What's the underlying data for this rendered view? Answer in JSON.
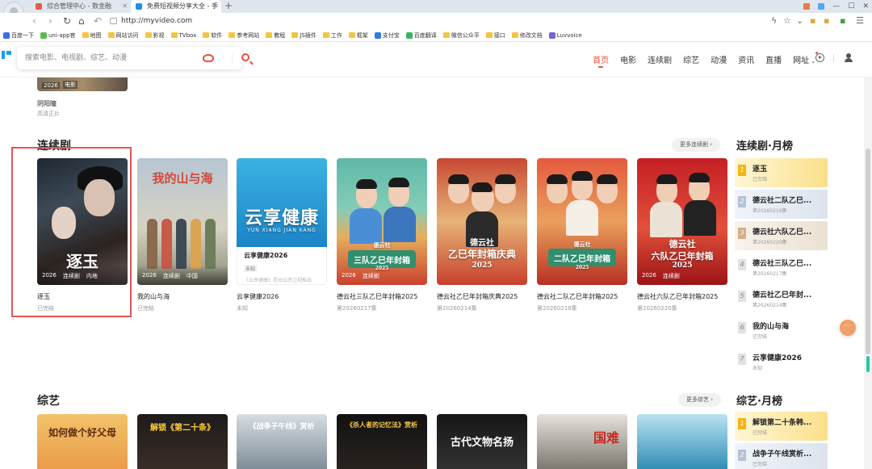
{
  "browser": {
    "tabs": [
      {
        "label": "综合管理中心 - 数金融"
      },
      {
        "label": "免费短视频分享大全 - 手"
      }
    ],
    "url": "http://myvideo.com",
    "bookmarks": [
      "百度一下",
      "uni-app官",
      "地图",
      "网站访问",
      "影视",
      "TVbox",
      "软件",
      "参考网站",
      "教程",
      "JS插件",
      "工作",
      "框架",
      "支付宝",
      "百度翻译",
      "微信公众平",
      "接口",
      "修改文档",
      "Luvvoice"
    ]
  },
  "site": {
    "search_placeholder": "搜索电影、电视剧、综艺、动漫",
    "nav": [
      "首页",
      "电影",
      "连续剧",
      "综艺",
      "动漫",
      "资讯",
      "直播",
      "网址"
    ]
  },
  "previous": {
    "tags": [
      "2026",
      "电影"
    ],
    "title": "阴阳瞳",
    "sub": "高清正片"
  },
  "drama_section": {
    "title": "连续剧",
    "more": "更多连续剧",
    "cards": [
      {
        "title": "逐玉",
        "sub": "已完结",
        "tags": [
          "2026",
          "连续剧",
          "内地"
        ],
        "poster_text": "逐玉"
      },
      {
        "title": "我的山与海",
        "sub": "已完结",
        "tags": [
          "2026",
          "连续剧",
          "中国"
        ],
        "poster_text": "我的山与海"
      },
      {
        "title": "云享健康2026",
        "sub": "未知",
        "tags": [],
        "poster_text": "云享健康",
        "poster_sub": "YUN XIANG JIAN KANG",
        "hover_title": "云享健康2026",
        "hover_tag": "未知",
        "hover_desc": "《云享健康》是由云南卫视推出"
      },
      {
        "title": "德云社三队乙巳年封箱2025",
        "sub": "第20260217集",
        "tags": [
          "2026",
          "连续剧"
        ],
        "poster_text": "三队乙巳年封箱",
        "poster_brand": "德云社",
        "poster_year": "2025"
      },
      {
        "title": "德云社乙巳年封箱庆典2025",
        "sub": "第20260214集",
        "tags": [],
        "poster_text": "乙巳年封箱庆典",
        "poster_brand": "德云社",
        "poster_year": "2025"
      },
      {
        "title": "德云社二队乙巳年封箱2025",
        "sub": "第20260216集",
        "tags": [],
        "poster_text": "二队乙巳年封箱",
        "poster_brand": "德云社",
        "poster_year": "2025"
      },
      {
        "title": "德云社六队乙巳年封箱2025",
        "sub": "第20260220集",
        "tags": [
          "2026",
          "连续剧"
        ],
        "poster_text": "六队乙巳年封箱",
        "poster_brand": "德云社",
        "poster_year": "2025"
      }
    ]
  },
  "drama_rank": {
    "title": "连续剧·月榜",
    "items": [
      {
        "num": "1",
        "name": "逐玉",
        "status": "已完结"
      },
      {
        "num": "2",
        "name": "德云社二队乙巳...",
        "status": "第20260216集"
      },
      {
        "num": "3",
        "name": "德云社六队乙巳...",
        "status": "第20260220集"
      },
      {
        "num": "4",
        "name": "德云社三队乙巳...",
        "status": "第20260217集"
      },
      {
        "num": "5",
        "name": "德云社乙巳年封...",
        "status": "第20260214集"
      },
      {
        "num": "6",
        "name": "我的山与海",
        "status": "已完结"
      },
      {
        "num": "7",
        "name": "云享健康2026",
        "status": "未知"
      }
    ]
  },
  "variety_section": {
    "title": "综艺",
    "more": "更多综艺",
    "posters": [
      "如何做个好父母",
      "解锁《第二十条》",
      "《战争子午线》赏析",
      "《杀人者的记忆法》赏析",
      "古代文物名扬",
      "国难",
      ""
    ]
  },
  "variety_rank": {
    "title": "综艺·月榜",
    "items": [
      {
        "num": "1",
        "name": "解锁第二十条韩...",
        "status": "已完结"
      },
      {
        "num": "2",
        "name": "战争子午线赏析...",
        "status": "已完结"
      }
    ]
  },
  "colors": {
    "accent": "#e4523c",
    "selection": "#e25555"
  }
}
